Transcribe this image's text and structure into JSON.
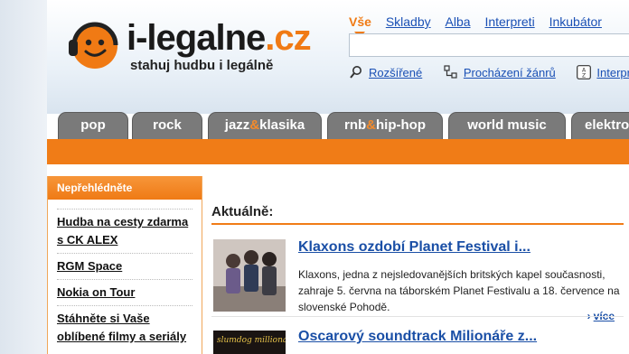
{
  "brand": {
    "name_main": "i-legalne",
    "name_tld": ".cz",
    "slogan": "stahuj hudbu i legálně",
    "accent": "#f07a14"
  },
  "search": {
    "tabs": [
      {
        "label": "Vše",
        "active": true
      },
      {
        "label": "Skladby",
        "active": false
      },
      {
        "label": "Alba",
        "active": false
      },
      {
        "label": "Interpreti",
        "active": false
      },
      {
        "label": "Inkubátor",
        "active": false
      }
    ],
    "query": ""
  },
  "tools": [
    {
      "label": "Rozšířené",
      "icon": "magnifier-icon"
    },
    {
      "label": "Procházení žánrů",
      "icon": "genre-tree-icon"
    },
    {
      "label": "Interpreti",
      "icon": "az-icon"
    }
  ],
  "genres": [
    {
      "label": "pop"
    },
    {
      "label": "rock"
    },
    {
      "label_a": "jazz",
      "amp": "&",
      "label_b": "klasika"
    },
    {
      "label_a": "rnb",
      "amp": "&",
      "label_b": "hip-hop"
    },
    {
      "label": "world music"
    },
    {
      "label": "elektro"
    }
  ],
  "sidebar": {
    "title": "Nepřehlédněte",
    "items": [
      "Hudba na cesty zdarma s CK ALEX",
      "RGM Space",
      "Nokia on Tour",
      "Stáhněte si Vaše oblíbené filmy a seriály"
    ]
  },
  "news": {
    "title": "Aktuálně:",
    "articles": [
      {
        "title": "Klaxons ozdobí Planet Festival i...",
        "text": "Klaxons, jedna z nejsledovanějších britských kapel současnosti, zahraje 5. června na táborském Planet Festivalu a 18. července na slovenské Pohodě.",
        "more": "více"
      },
      {
        "title": "Oscarový soundtrack Milionáře z...",
        "thumb_caption": "slumdog millionaire"
      }
    ]
  }
}
